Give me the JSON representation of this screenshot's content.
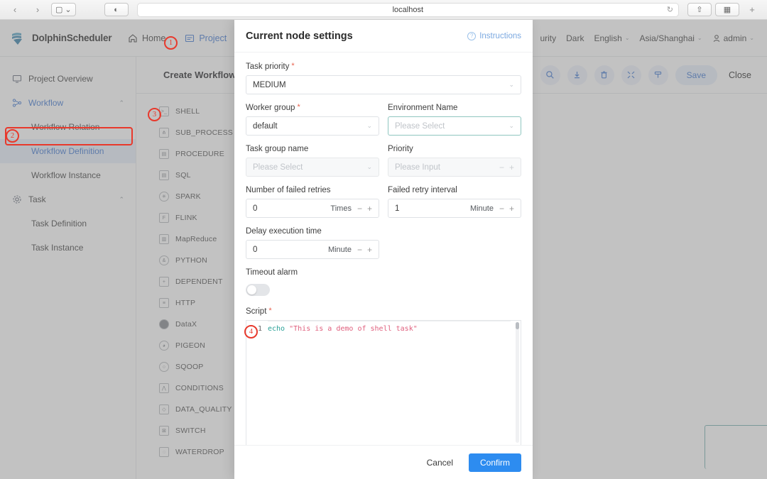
{
  "browser": {
    "back_label": "‹",
    "forward_label": "›",
    "sidebar_toggle_label": "▢",
    "sidebar_caret": "⌄",
    "reader_label": "◐",
    "url": "localhost",
    "reload_label": "↻",
    "share_label": "⇧",
    "tabs_label": "▦",
    "newtab_label": "+"
  },
  "header": {
    "brand": "DolphinScheduler",
    "nav": [
      {
        "label": "Home",
        "icon": "home-icon",
        "active": false
      },
      {
        "label": "Project",
        "icon": "project-icon",
        "active": true
      },
      {
        "label": "",
        "icon": "folder-icon",
        "active": false
      }
    ],
    "security_label": "urity",
    "theme_label": "Dark",
    "language_label": "English",
    "timezone_label": "Asia/Shanghai",
    "user_label": "admin",
    "caret": "⌄"
  },
  "sidebar": {
    "items": [
      {
        "label": "Project Overview",
        "icon": "overview-icon",
        "type": "group-plain",
        "selected": false
      },
      {
        "label": "Workflow",
        "icon": "workflow-icon",
        "type": "group",
        "selected": false,
        "chevron": "⌃"
      },
      {
        "label": "Workflow Relation",
        "icon": "",
        "type": "sub",
        "selected": false
      },
      {
        "label": "Workflow Definition",
        "icon": "",
        "type": "sub",
        "selected": true
      },
      {
        "label": "Workflow Instance",
        "icon": "",
        "type": "sub",
        "selected": false
      },
      {
        "label": "Task",
        "icon": "gear-icon",
        "type": "group-plain",
        "selected": false,
        "chevron": "⌃"
      },
      {
        "label": "Task Definition",
        "icon": "",
        "type": "sub",
        "selected": false
      },
      {
        "label": "Task Instance",
        "icon": "",
        "type": "sub",
        "selected": false
      }
    ]
  },
  "toolbar": {
    "workflow_title": "Create Workflow",
    "icons": [
      {
        "name": "search-icon",
        "glyph": "🔍"
      },
      {
        "name": "download-icon",
        "glyph": "⭳"
      },
      {
        "name": "delete-icon",
        "glyph": "🗑"
      },
      {
        "name": "fullscreen-icon",
        "glyph": "⤡"
      },
      {
        "name": "format-icon",
        "glyph": "⊤"
      }
    ],
    "save_label": "Save",
    "close_label": "Close"
  },
  "palette": {
    "tasks": [
      {
        "label": "SHELL",
        "icon": "shell-icon"
      },
      {
        "label": "SUB_PROCESS",
        "icon": "sub-process-icon"
      },
      {
        "label": "PROCEDURE",
        "icon": "procedure-icon"
      },
      {
        "label": "SQL",
        "icon": "sql-icon"
      },
      {
        "label": "SPARK",
        "icon": "spark-icon"
      },
      {
        "label": "FLINK",
        "icon": "flink-icon"
      },
      {
        "label": "MapReduce",
        "icon": "mapreduce-icon"
      },
      {
        "label": "PYTHON",
        "icon": "python-icon"
      },
      {
        "label": "DEPENDENT",
        "icon": "dependent-icon"
      },
      {
        "label": "HTTP",
        "icon": "http-icon"
      },
      {
        "label": "DataX",
        "icon": "datax-icon"
      },
      {
        "label": "PIGEON",
        "icon": "pigeon-icon"
      },
      {
        "label": "SQOOP",
        "icon": "sqoop-icon"
      },
      {
        "label": "CONDITIONS",
        "icon": "conditions-icon"
      },
      {
        "label": "DATA_QUALITY",
        "icon": "data-quality-icon"
      },
      {
        "label": "SWITCH",
        "icon": "switch-icon"
      },
      {
        "label": "WATERDROP",
        "icon": "waterdrop-icon"
      }
    ]
  },
  "modal": {
    "title": "Current node settings",
    "instructions_label": "Instructions",
    "fields": {
      "task_priority": {
        "label": "Task priority",
        "required": true,
        "value": "MEDIUM"
      },
      "worker_group": {
        "label": "Worker group",
        "required": true,
        "value": "default"
      },
      "environment_name": {
        "label": "Environment Name",
        "required": false,
        "placeholder": "Please Select"
      },
      "task_group_name": {
        "label": "Task group name",
        "required": false,
        "placeholder": "Please Select"
      },
      "priority": {
        "label": "Priority",
        "required": false,
        "placeholder": "Please Input"
      },
      "failed_retries": {
        "label": "Number of failed retries",
        "required": false,
        "value": "0",
        "unit": "Times"
      },
      "retry_interval": {
        "label": "Failed retry interval",
        "required": false,
        "value": "1",
        "unit": "Minute"
      },
      "delay_execution": {
        "label": "Delay execution time",
        "required": false,
        "value": "0",
        "unit": "Minute"
      },
      "timeout_alarm": {
        "label": "Timeout alarm",
        "required": false,
        "enabled": false
      },
      "script": {
        "label": "Script",
        "required": true,
        "line_number": "1",
        "code_keyword": "echo",
        "code_string": " \"This is a demo of shell task\""
      }
    },
    "minus_label": "−",
    "plus_label": "+",
    "cancel_label": "Cancel",
    "confirm_label": "Confirm"
  },
  "annotations": {
    "markers": [
      {
        "number": "1"
      },
      {
        "number": "2"
      },
      {
        "number": "3"
      },
      {
        "number": "4"
      }
    ]
  },
  "colors": {
    "accent_blue": "#4a7fd4",
    "confirm_blue": "#2d8cf0",
    "marker_red": "#e8392c",
    "code_keyword": "#2aa198",
    "code_string": "#e0607e",
    "focus_teal": "#8fc6c0"
  }
}
